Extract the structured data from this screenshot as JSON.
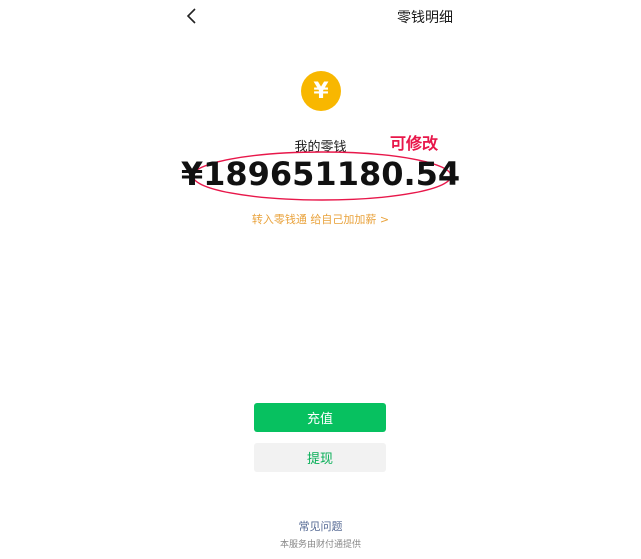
{
  "header": {
    "back_icon": "chevron-left-icon",
    "detail_link": "零钱明细"
  },
  "wallet": {
    "coin_symbol": "¥",
    "coin_color": "#f8b700",
    "label": "我的零钱",
    "amount": "¥189651180.54",
    "annotation": "可修改",
    "annotation_color": "#e8174a",
    "promo_link": "转入零钱通 给自己加加薪 >"
  },
  "actions": {
    "recharge_label": "充值",
    "recharge_color": "#07c160",
    "withdraw_label": "提现"
  },
  "footer": {
    "faq_link": "常见问题",
    "provider_note": "本服务由财付通提供"
  }
}
